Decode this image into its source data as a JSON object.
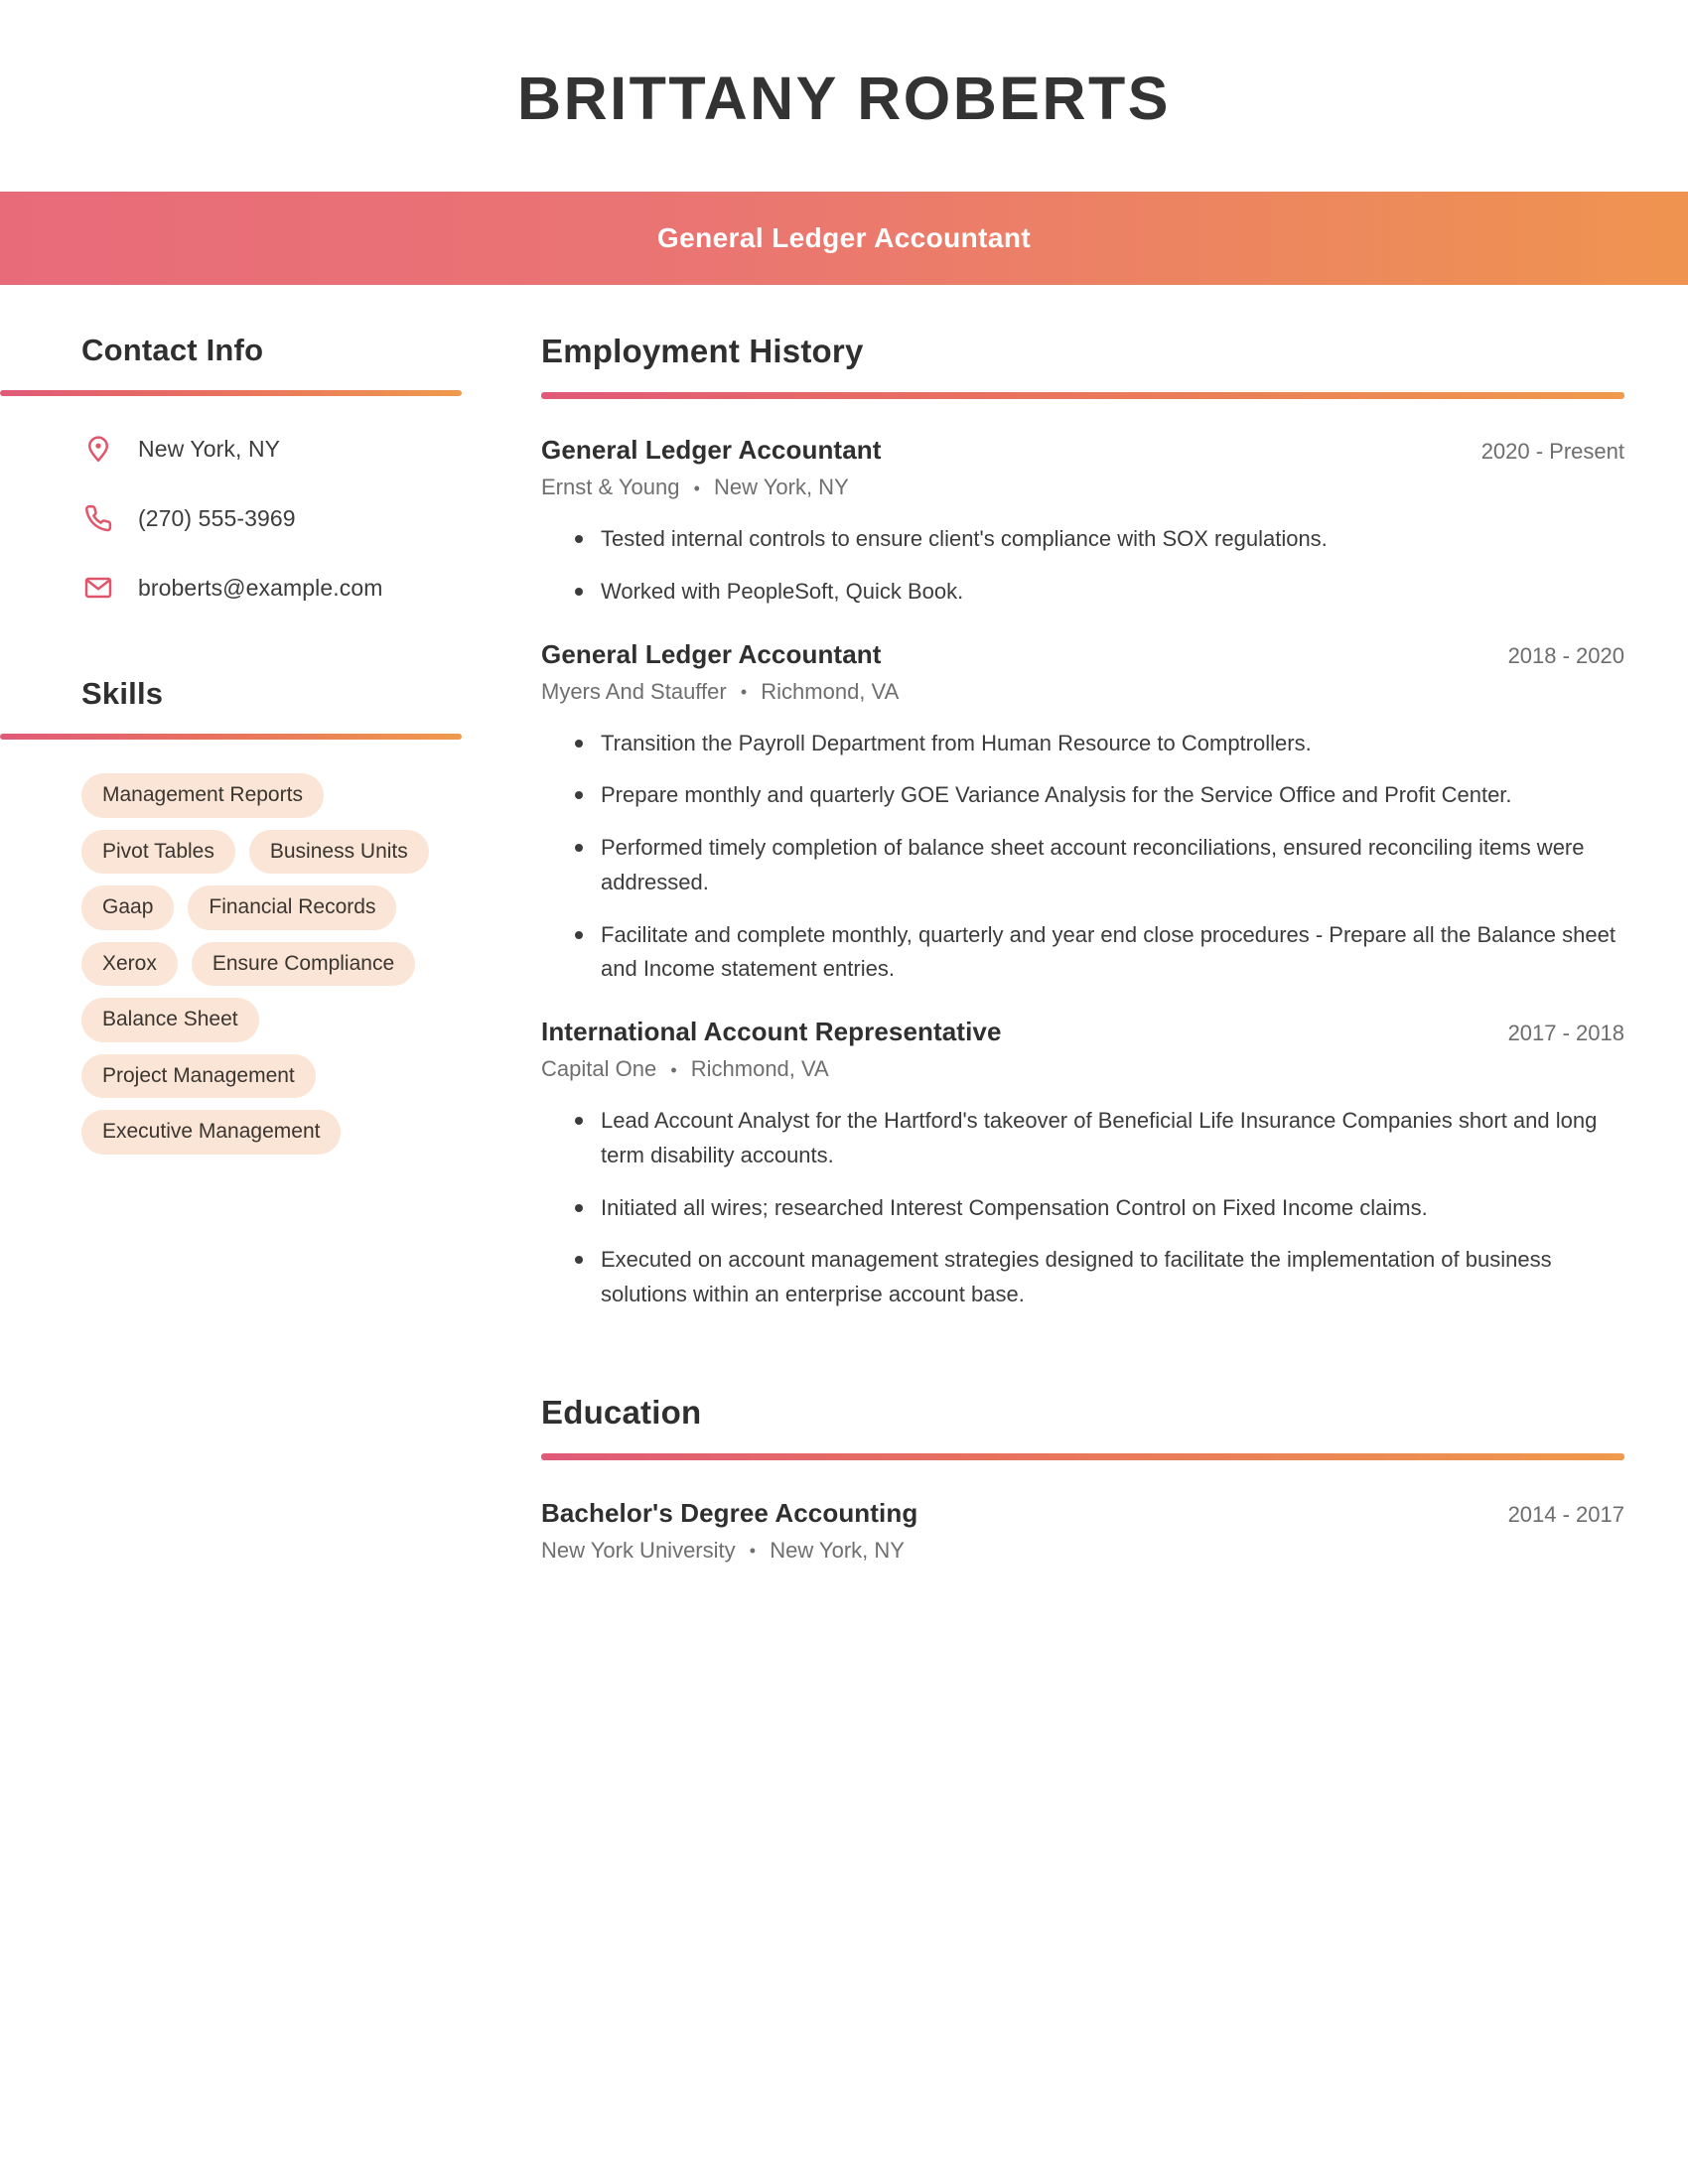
{
  "header": {
    "full_name": "BRITTANY ROBERTS",
    "job_title": "General Ledger Accountant"
  },
  "theme": {
    "gradient_start": "#e86b7a",
    "gradient_end": "#ef9450",
    "icon_color": "#e0566b",
    "chip_background": "#fae5d6",
    "heading_color": "#2f2f2f"
  },
  "sidebar": {
    "contact": {
      "title": "Contact Info",
      "items": [
        {
          "icon": "location-pin-icon",
          "text": "New York, NY"
        },
        {
          "icon": "phone-icon",
          "text": "(270) 555-3969"
        },
        {
          "icon": "email-envelope-icon",
          "text": "broberts@example.com"
        }
      ]
    },
    "skills": {
      "title": "Skills",
      "items": [
        "Management Reports",
        "Pivot Tables",
        "Business Units",
        "Gaap",
        "Financial Records",
        "Xerox",
        "Ensure Compliance",
        "Balance Sheet",
        "Project Management",
        "Executive Management"
      ]
    }
  },
  "main": {
    "employment": {
      "title": "Employment History",
      "entries": [
        {
          "role": "General Ledger Accountant",
          "dates": "2020 - Present",
          "company": "Ernst & Young",
          "location": "New York, NY",
          "bullets": [
            "Tested internal controls to ensure client's compliance with SOX regulations.",
            "Worked with PeopleSoft, Quick Book."
          ]
        },
        {
          "role": "General Ledger Accountant",
          "dates": "2018 - 2020",
          "company": "Myers And Stauffer",
          "location": "Richmond, VA",
          "bullets": [
            "Transition the Payroll Department from Human Resource to Comptrollers.",
            "Prepare monthly and quarterly GOE Variance Analysis for the Service Office and Profit Center.",
            "Performed timely completion of balance sheet account reconciliations, ensured reconciling items were addressed.",
            "Facilitate and complete monthly, quarterly and year end close procedures - Prepare all the Balance sheet and Income statement entries."
          ]
        },
        {
          "role": "International Account Representative",
          "dates": "2017 - 2018",
          "company": "Capital One",
          "location": "Richmond, VA",
          "bullets": [
            "Lead Account Analyst for the Hartford's takeover of Beneficial Life Insurance Companies short and long term disability accounts.",
            "Initiated all wires; researched Interest Compensation Control on Fixed Income claims.",
            "Executed on account management strategies designed to facilitate the implementation of business solutions within an enterprise account base."
          ]
        }
      ]
    },
    "education": {
      "title": "Education",
      "entries": [
        {
          "degree": "Bachelor's Degree Accounting",
          "dates": "2014 - 2017",
          "school": "New York University",
          "location": "New York, NY"
        }
      ]
    }
  },
  "separator": "•"
}
